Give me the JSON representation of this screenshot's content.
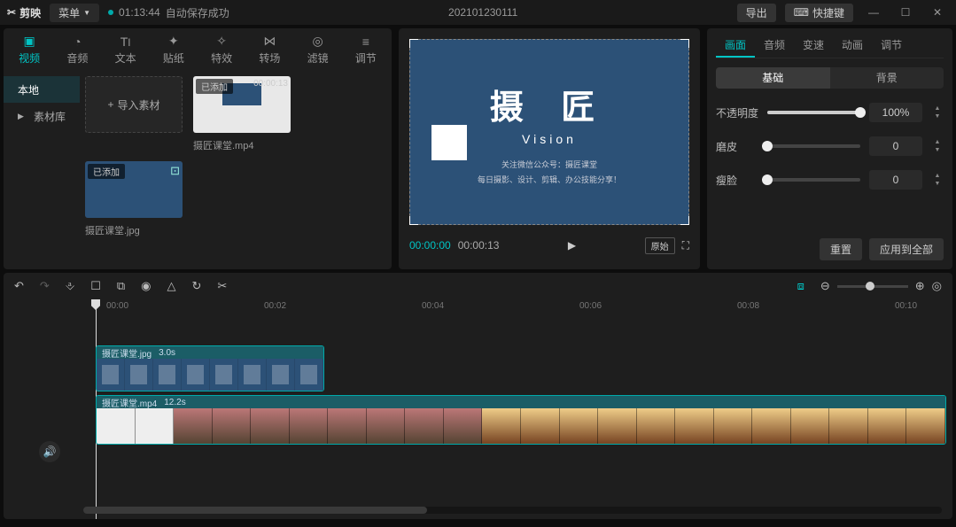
{
  "titlebar": {
    "app_name": "剪映",
    "menu": "菜单",
    "autosave_time": "01:13:44",
    "autosave_text": "自动保存成功",
    "project_name": "202101230111",
    "export": "导出",
    "shortcuts": "快捷键"
  },
  "media_tabs": [
    {
      "icon": "▸",
      "label": "视频",
      "active": true
    },
    {
      "icon": "◔",
      "label": "音频"
    },
    {
      "icon": "TI",
      "label": "文本"
    },
    {
      "icon": "✦",
      "label": "贴纸"
    },
    {
      "icon": "✧",
      "label": "特效"
    },
    {
      "icon": "⋈",
      "label": "转场"
    },
    {
      "icon": "◉",
      "label": "滤镜"
    },
    {
      "icon": "⚙",
      "label": "调节"
    }
  ],
  "media_side": [
    {
      "label": "本地",
      "active": true
    },
    {
      "label": "素材库",
      "arrow": true
    }
  ],
  "import_label": "导入素材",
  "media_items": [
    {
      "badge": "已添加",
      "duration": "00:00:13",
      "name": "摄匠课堂.mp4",
      "kind": "mp4"
    },
    {
      "badge": "已添加",
      "duration": "",
      "name": "摄匠课堂.jpg",
      "kind": "jpg"
    }
  ],
  "preview": {
    "logo": "摄 匠",
    "sub": "Vision",
    "line1": "关注微信公众号：摄匠课堂",
    "line2": "每日摄影、设计、剪辑、办公技能分享！",
    "time_current": "00:00:00",
    "time_total": "00:00:13",
    "ratio": "原始"
  },
  "prop_tabs": [
    {
      "label": "画面",
      "active": true
    },
    {
      "label": "音频"
    },
    {
      "label": "变速"
    },
    {
      "label": "动画"
    },
    {
      "label": "调节"
    }
  ],
  "seg": [
    {
      "label": "基础",
      "active": true
    },
    {
      "label": "背景"
    }
  ],
  "sliders": {
    "opacity": {
      "label": "不透明度",
      "value": "100%",
      "pct": 100
    },
    "skin": {
      "label": "磨皮",
      "value": "0",
      "pct": 0
    },
    "face": {
      "label": "瘦脸",
      "value": "0",
      "pct": 0
    }
  },
  "buttons": {
    "reset": "重置",
    "apply_all": "应用到全部"
  },
  "timeline": {
    "ticks": [
      "00:00",
      "00:02",
      "00:04",
      "00:06",
      "00:08",
      "00:10"
    ],
    "clip_a": {
      "name": "摄匠课堂.jpg",
      "dur": "3.0s"
    },
    "clip_b": {
      "name": "摄匠课堂.mp4",
      "dur": "12.2s"
    }
  }
}
